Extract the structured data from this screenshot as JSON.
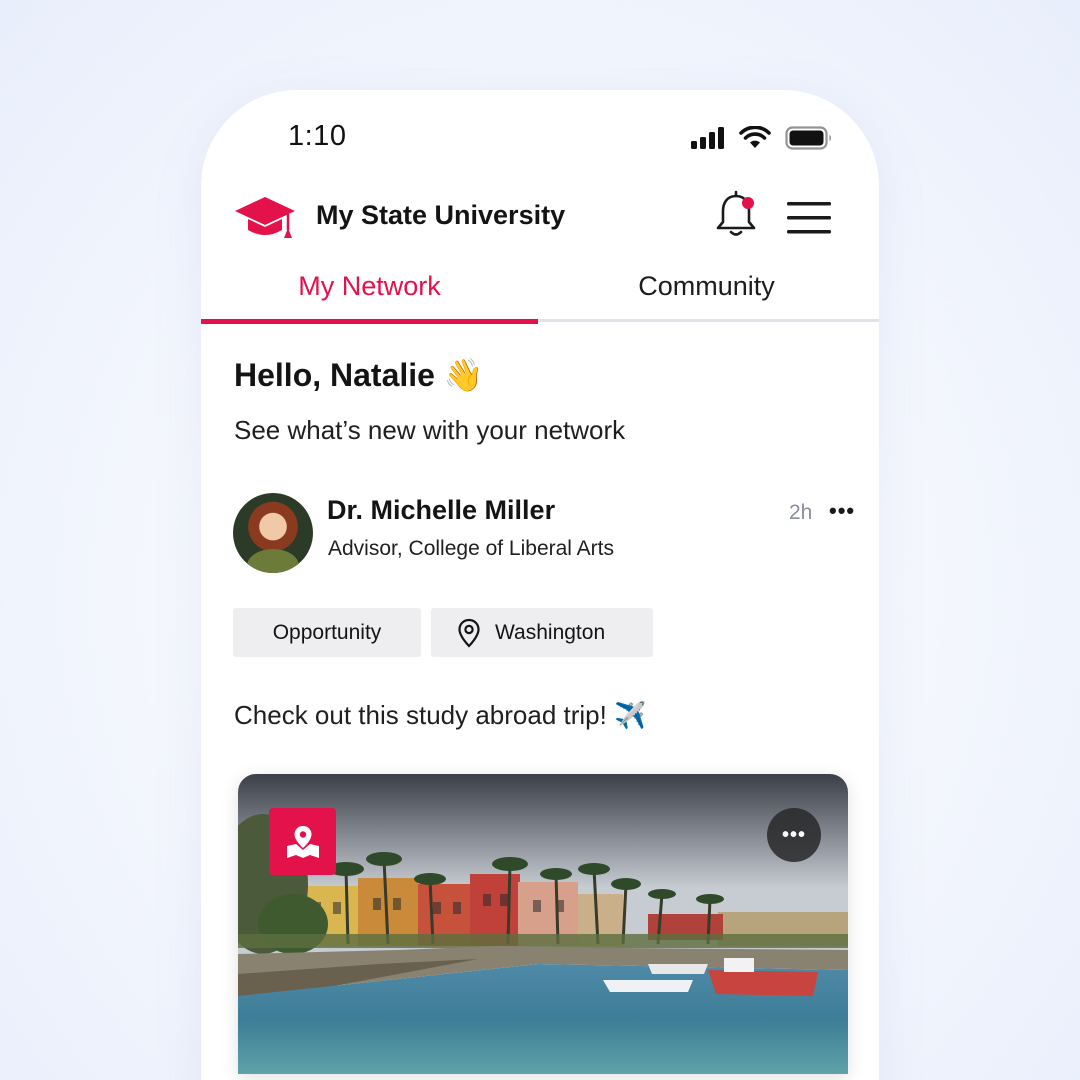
{
  "status_bar": {
    "time": "1:10",
    "icons": [
      "signal-icon",
      "wifi-icon",
      "battery-icon"
    ]
  },
  "header": {
    "app_title": "My State University",
    "logo_icon": "graduation-cap-icon",
    "notification_icon": "bell-icon",
    "menu_icon": "hamburger-menu-icon"
  },
  "tabs": [
    {
      "label": "My Network",
      "active": true
    },
    {
      "label": "Community",
      "active": false
    }
  ],
  "greeting": {
    "title": "Hello, Natalie 👋",
    "subtitle": "See what’s new with your network"
  },
  "post": {
    "author_name": "Dr. Michelle Miller",
    "author_role": "Advisor, College of Liberal Arts",
    "time_ago": "2h",
    "more_label": "•••",
    "tags": [
      {
        "label": "Opportunity"
      },
      {
        "label": "Washington",
        "icon": "location-pin-icon"
      }
    ],
    "text": "Check out this study abroad trip! ✈️",
    "image": {
      "badge_icon": "map-location-icon",
      "more_label": "•••"
    }
  },
  "colors": {
    "accent": "#e3124b",
    "tab_inactive_underline": "#e1e3e8",
    "tag_background": "#eeeef0",
    "muted_text": "#8a8f9c"
  }
}
